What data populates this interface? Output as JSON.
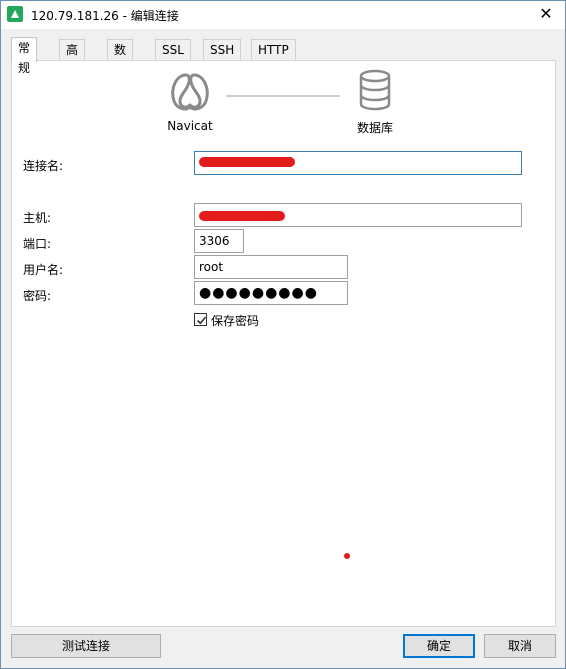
{
  "window": {
    "title": "120.79.181.26 - 编辑连接",
    "close_symbol": "✕"
  },
  "tabs": [
    {
      "label": "常规",
      "active": true
    },
    {
      "label": "高级"
    },
    {
      "label": "数据库"
    },
    {
      "label": "SSL"
    },
    {
      "label": "SSH"
    },
    {
      "label": "HTTP"
    }
  ],
  "diagram": {
    "left_label": "Navicat",
    "right_label": "数据库",
    "left_icon": "navicat-logo-icon",
    "right_icon": "database-icon"
  },
  "form": {
    "connection_name_label": "连接名:",
    "connection_name_value": "",
    "host_label": "主机:",
    "host_value": "",
    "port_label": "端口:",
    "port_value": "3306",
    "username_label": "用户名:",
    "username_value": "root",
    "password_label": "密码:",
    "password_value": "●●●●●●●●●",
    "save_password_label": "保存密码",
    "save_password_checked": true
  },
  "buttons": {
    "test": "测试连接",
    "ok": "确定",
    "cancel": "取消"
  },
  "colors": {
    "accent": "#0078d7",
    "redaction": "#e21b1b",
    "app_icon": "#22a85a"
  }
}
